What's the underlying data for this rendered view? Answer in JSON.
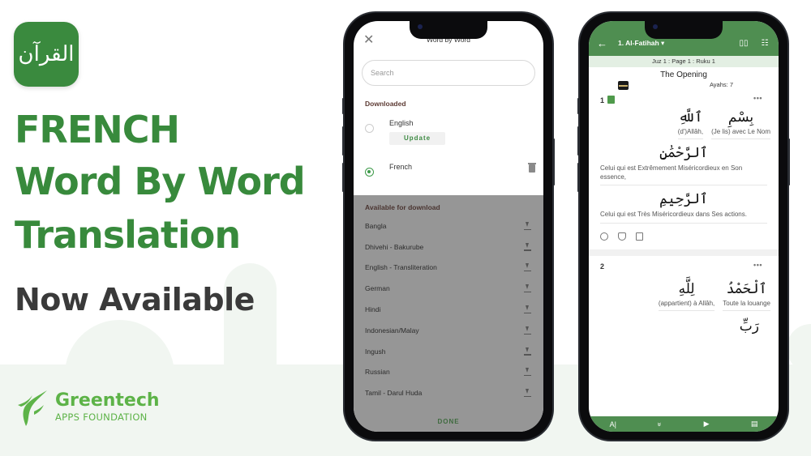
{
  "promo": {
    "app_icon_glyph": "القرآن",
    "headline_line1": "FRENCH",
    "headline_line2": "Word By Word",
    "headline_line3": "Translation",
    "subheadline": "Now Available",
    "brand_name": "Greentech",
    "brand_sub": "APPS FOUNDATION",
    "colors": {
      "primary_green": "#388a3c",
      "brand_green": "#5db348",
      "dark_text": "#3a3a3a"
    }
  },
  "left_phone": {
    "title": "Word by Word",
    "close_icon": "✕",
    "search_placeholder": "Search",
    "downloaded_label": "Downloaded",
    "downloaded": [
      {
        "name": "English",
        "selected": false,
        "action": "Update"
      },
      {
        "name": "French",
        "selected": true,
        "action": "delete"
      }
    ],
    "available_label": "Available for download",
    "available": [
      "Bangla",
      "Dhivehi - Bakurube",
      "English - Transliteration",
      "German",
      "Hindi",
      "Indonesian/Malay",
      "Ingush",
      "Russian",
      "Tamil - Darul Huda"
    ],
    "done_label": "DONE"
  },
  "right_phone": {
    "back_icon": "←",
    "surah_selector": "1. Al-Fatihah ▾",
    "book_icon": "▯▯",
    "settings_icon": "☷",
    "juz_info": "Juz 1 : Page 1 : Ruku 1",
    "surah_name": "The Opening",
    "ayahs_count": "Ayahs: 7",
    "ayah1": {
      "number": "1",
      "more": "•••",
      "words_row": [
        {
          "arabic": "ٱللَّهِ",
          "translation": "(d')Allâh,"
        },
        {
          "arabic": "بِسْمِ",
          "translation": "(Je lis) avec Le Nom"
        }
      ],
      "word3": {
        "arabic": "ٱلرَّحْمَٰنِ",
        "translation": "Celui qui est Extrêmement Miséricordieux en Son essence,"
      },
      "word4": {
        "arabic": "ٱلرَّحِيمِ",
        "translation": "Celui qui est Très Miséricordieux dans Ses actions."
      }
    },
    "ayah2": {
      "number": "2",
      "more": "•••",
      "words_row": [
        {
          "arabic": "لِلَّهِ",
          "translation": "(appartient) à Allâh,"
        },
        {
          "arabic": "ٱلْحَمْدُ",
          "translation": "Toute la louange"
        }
      ],
      "word3": {
        "arabic": "رَبِّ"
      }
    },
    "bottom_bar": {
      "font_icon": "A|",
      "scroll_icon": "»",
      "play_icon": "▶",
      "notes_icon": "▤"
    }
  }
}
